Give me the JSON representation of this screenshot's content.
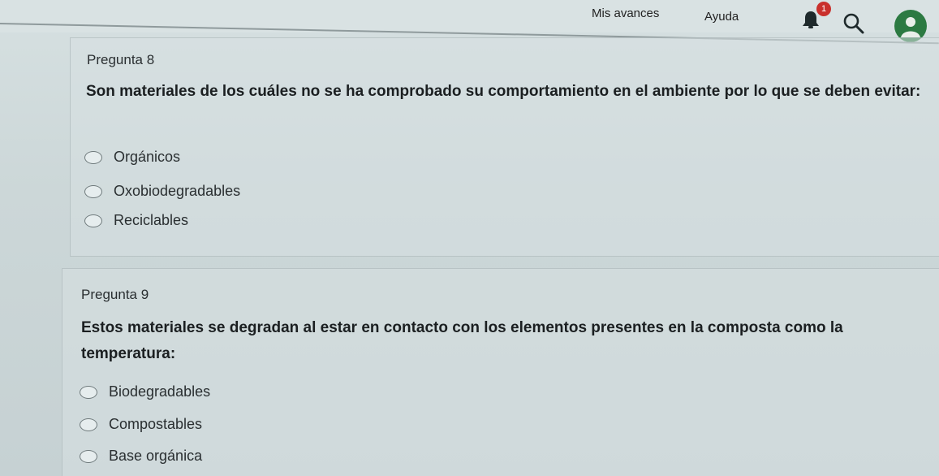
{
  "nav": {
    "mis_avances": "Mis avances",
    "ayuda": "Ayuda",
    "notification_count": "1",
    "icons": [
      "bell-icon",
      "search-icon",
      "user-avatar-icon"
    ],
    "avatar_color": "#2c7a42",
    "badge_color": "#c9302c"
  },
  "questions": [
    {
      "number": "Pregunta 8",
      "text": "Son materiales de los cuáles no se ha comprobado su comportamiento en el ambiente por lo que se deben evitar:",
      "options": [
        "Orgánicos",
        "Oxobiodegradables",
        "Reciclables"
      ]
    },
    {
      "number": "Pregunta 9",
      "text": "Estos materiales se degradan al estar en contacto con los elementos presentes en la composta como la temperatura:",
      "options": [
        "Biodegradables",
        "Compostables",
        "Base orgánica"
      ]
    }
  ]
}
